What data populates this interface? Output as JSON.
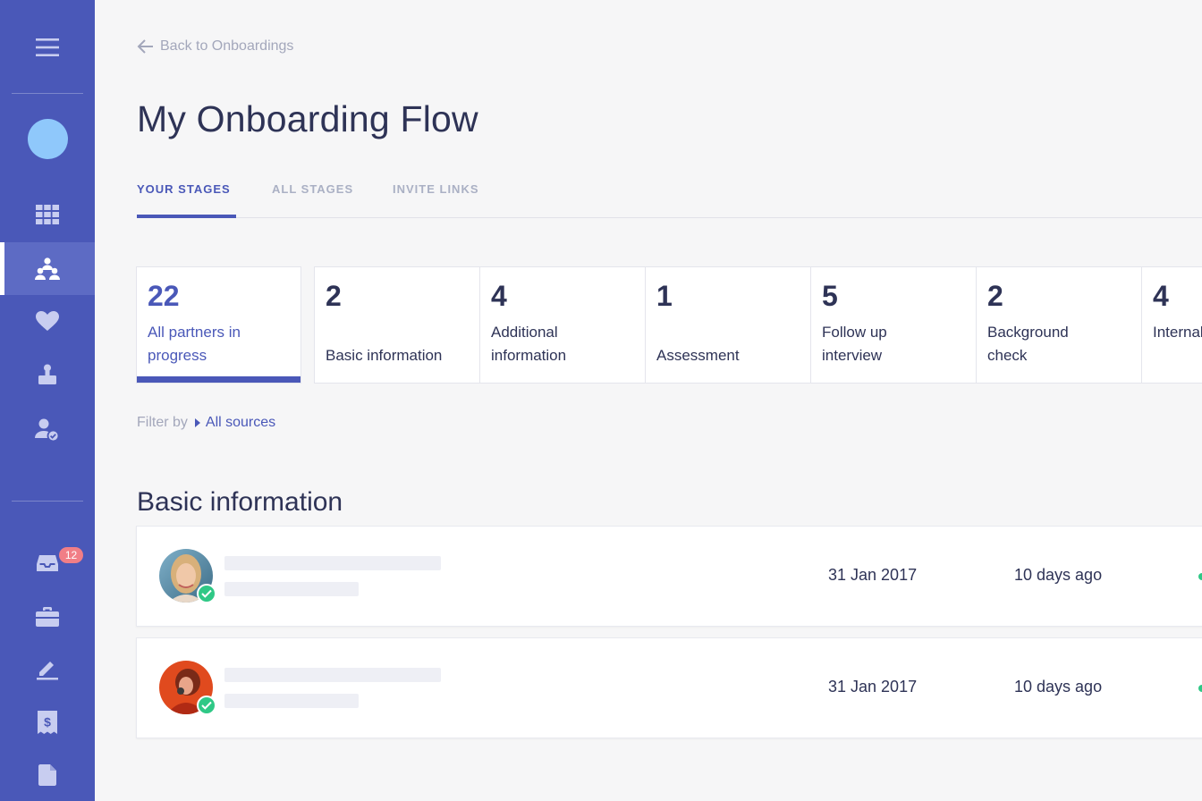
{
  "back_link": "Back to Onboardings",
  "page_title": "My Onboarding Flow",
  "tabs": [
    {
      "label": "YOUR STAGES",
      "active": true
    },
    {
      "label": "ALL STAGES",
      "active": false
    },
    {
      "label": "INVITE LINKS",
      "active": false
    }
  ],
  "stages": [
    {
      "count": "22",
      "label": "All partners in progress",
      "active": true
    },
    {
      "count": "2",
      "label": "Basic information",
      "active": false
    },
    {
      "count": "4",
      "label": "Additional information",
      "active": false
    },
    {
      "count": "1",
      "label": "Assessment",
      "active": false
    },
    {
      "count": "5",
      "label": "Follow up interview",
      "active": false
    },
    {
      "count": "2",
      "label": "Background check",
      "active": false
    },
    {
      "count": "4",
      "label": "Internal stage",
      "active": false
    }
  ],
  "filter": {
    "prefix": "Filter by",
    "value": "All sources"
  },
  "section_title": "Basic information",
  "rows": [
    {
      "date": "31 Jan 2017",
      "ago": "10 days ago",
      "verified": true
    },
    {
      "date": "31 Jan 2017",
      "ago": "10 days ago",
      "verified": true
    }
  ],
  "sidebar": {
    "inbox_badge": "12",
    "active_item": "partners",
    "icons": [
      "menu-icon",
      "dashboard-icon",
      "partners-icon",
      "heart-icon",
      "onboarding-icon",
      "user-check-icon",
      "inbox-icon",
      "briefcase-icon",
      "edit-icon",
      "receipt-icon",
      "document-icon"
    ]
  },
  "colors": {
    "accent": "#4a58b8",
    "sidebar": "#4a58b8",
    "success": "#2fc886",
    "badge": "#f17e86"
  }
}
